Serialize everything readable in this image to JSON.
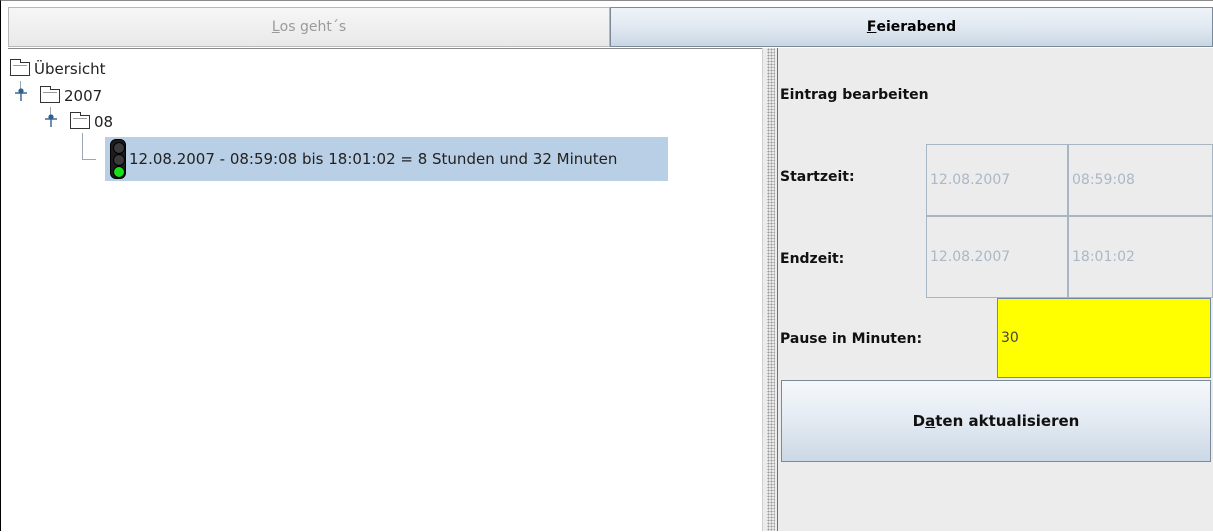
{
  "tabs": {
    "start_label_access": "L",
    "start_label_rest": "os geht´s",
    "end_label_access": "F",
    "end_label_rest": "eierabend"
  },
  "tree": {
    "root": {
      "label": "Übersicht",
      "icon": "folder-icon"
    },
    "year": {
      "label": "2007",
      "icon": "folder-icon"
    },
    "month": {
      "label": "08",
      "icon": "folder-icon"
    },
    "entry": {
      "label": "12.08.2007 - 08:59:08 bis 18:01:02 = 8 Stunden und 32 Minuten",
      "icon": "traffic-light-icon",
      "light_colors": {
        "top": "#3a3a3a",
        "middle": "#3a3a3a",
        "bottom": "#18e018"
      }
    }
  },
  "form": {
    "heading": "Eintrag bearbeiten",
    "start_label": "Startzeit:",
    "start_date": "12.08.2007",
    "start_time": "08:59:08",
    "end_label": "Endzeit:",
    "end_date": "12.08.2007",
    "end_time": "18:01:02",
    "pause_label": "Pause in Minuten:",
    "pause_value": "30",
    "update_access": "a",
    "update_pre": "D",
    "update_post": "ten aktualisieren"
  },
  "colors": {
    "selection": "#b8cfe5",
    "pause_field": "#ffff00"
  }
}
